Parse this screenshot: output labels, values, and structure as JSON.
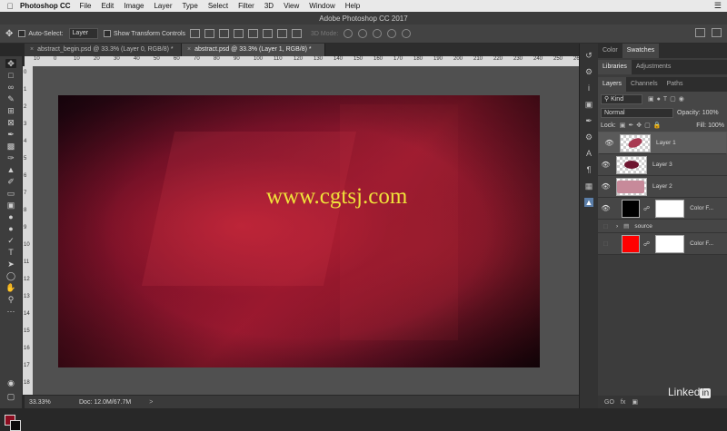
{
  "menubar": {
    "app_name": "Photoshop CC",
    "items": [
      "File",
      "Edit",
      "Image",
      "Layer",
      "Type",
      "Select",
      "Filter",
      "3D",
      "View",
      "Window",
      "Help"
    ]
  },
  "window": {
    "title": "Adobe Photoshop CC 2017"
  },
  "options_bar": {
    "auto_select_label": "Auto-Select:",
    "auto_select_value": "Layer",
    "show_transform_label": "Show Transform Controls",
    "mode_3d_label": "3D Mode:"
  },
  "tabs": [
    {
      "label": "abstract_begin.psd @ 33.3% (Layer 0, RGB/8) *"
    },
    {
      "label": "abstract.psd @ 33.3% (Layer 1, RGB/8) *"
    }
  ],
  "ruler": {
    "h_ticks": [
      "10",
      "0",
      "10",
      "20",
      "30",
      "40",
      "50",
      "60",
      "70",
      "80",
      "90",
      "100",
      "110",
      "120",
      "130",
      "140",
      "150",
      "160",
      "170",
      "180",
      "190",
      "200",
      "210",
      "220",
      "230",
      "240",
      "250",
      "260"
    ],
    "v_ticks": [
      "0",
      "1",
      "2",
      "3",
      "4",
      "5",
      "6",
      "7",
      "8",
      "9",
      "10",
      "11",
      "12",
      "13",
      "14",
      "15",
      "16",
      "17",
      "18"
    ]
  },
  "canvas": {
    "watermark": "www.cgtsj.com"
  },
  "status": {
    "zoom": "33.33%",
    "doc_info": "Doc: 12.0M/67.7M",
    "arrow": ">"
  },
  "panels": {
    "group1_tabs": [
      "Color",
      "Swatches"
    ],
    "group2_tabs": [
      "Libraries",
      "Adjustments"
    ],
    "group3_tabs": [
      "Layers",
      "Channels",
      "Paths"
    ],
    "filter_kind": "Kind",
    "blend_mode": "Normal",
    "opacity_label": "Opacity:",
    "opacity_value": "100%",
    "lock_label": "Lock:",
    "fill_label": "Fill:",
    "fill_value": "100%",
    "layers": [
      {
        "name": "Layer 1",
        "selected": true
      },
      {
        "name": "Layer 3",
        "selected": false
      },
      {
        "name": "Layer 2",
        "selected": false
      },
      {
        "name": "Color F...",
        "selected": false
      },
      {
        "name": "source",
        "selected": false
      },
      {
        "name": "Color F...",
        "selected": false
      }
    ],
    "footer_icons": [
      "GO",
      "fx"
    ]
  },
  "colors": {
    "foreground": "#8c0d20",
    "background": "#0b0b0b",
    "fill_black": "#000000",
    "fill_red": "#ff0000"
  },
  "branding": {
    "linkedin_text": "Linked",
    "linkedin_in": "in"
  }
}
